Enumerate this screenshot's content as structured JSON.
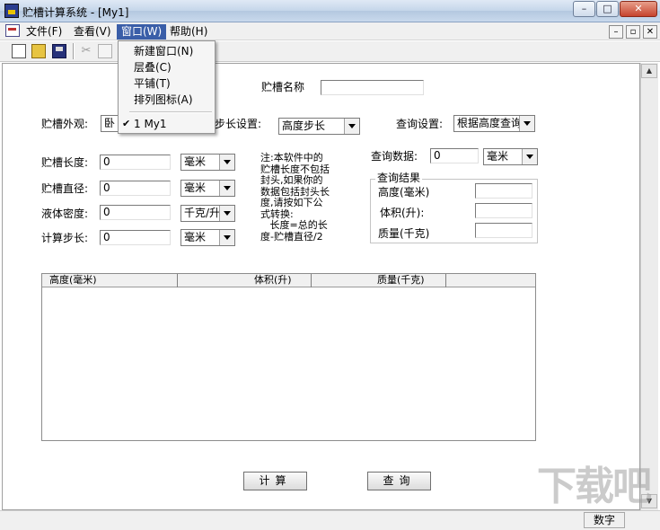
{
  "window": {
    "title": "贮槽计算系统 - [My1]"
  },
  "menubar": {
    "file": "文件(F)",
    "view": "查看(V)",
    "window": "窗口(W)",
    "help": "帮助(H)"
  },
  "window_menu": {
    "items": [
      "新建窗口(N)",
      "层叠(C)",
      "平铺(T)",
      "排列图标(A)"
    ],
    "docs": [
      "1 My1"
    ],
    "check_mark": "✔"
  },
  "form": {
    "name_label": "贮槽名称",
    "name_value": "",
    "shape_label": "贮槽外观:",
    "shape_value": "卧",
    "step_setting_label": "步长设置:",
    "step_setting_value": "高度步长",
    "query_setting_label": "查询设置:",
    "query_setting_value": "根据高度查询",
    "length_label": "贮槽长度:",
    "length_value": "0",
    "length_unit": "毫米",
    "diameter_label": "贮槽直径:",
    "diameter_value": "0",
    "diameter_unit": "毫米",
    "density_label": "液体密度:",
    "density_value": "0",
    "density_unit": "千克/升",
    "step_label": "计算步长:",
    "step_value": "0",
    "step_unit": "毫米",
    "note_lines": [
      "注:本软件中的",
      "贮槽长度不包括",
      "封头,如果你的",
      "数据包括封头长",
      "度,请按如下公",
      "式转换:",
      "   长度=总的长",
      "度-贮槽直径/2"
    ],
    "query_data_label": "查询数据:",
    "query_data_value": "0",
    "query_data_unit": "毫米",
    "result_group_title": "查询结果",
    "result_height_label": "高度(毫米)",
    "result_volume_label": "体积(升):",
    "result_mass_label": "质量(千克)",
    "result_height_value": "",
    "result_volume_value": "",
    "result_mass_value": ""
  },
  "table": {
    "columns": [
      "高度(毫米)",
      "体积(升)",
      "质量(千克)"
    ],
    "rows": []
  },
  "buttons": {
    "calculate": "计算",
    "query": "查询"
  },
  "statusbar": {
    "num": "数字"
  },
  "watermark": "下载吧"
}
